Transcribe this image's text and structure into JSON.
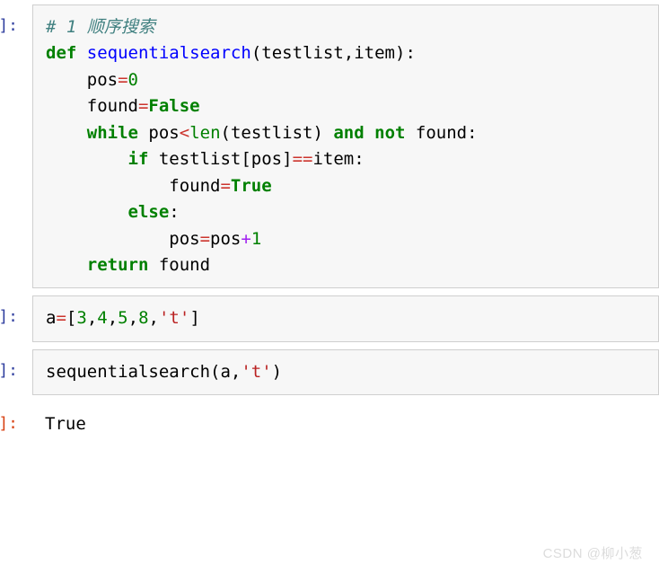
{
  "cell1": {
    "prompt_suffix": "]:",
    "c1": "# 1 顺序搜索",
    "kw_def": "def",
    "fn_name": "sequential",
    "fn_name2": "search",
    "open_paren": "(",
    "p1": "testlist",
    "comma1": ",",
    "p2": "item",
    "close_paren": "):",
    "l3a": "    pos",
    "eq1": "=",
    "zero": "0",
    "l4a": "    found",
    "eq2": "=",
    "false_kw": "False",
    "kw_while": "while",
    "l5a": " pos",
    "lt": "<",
    "len_fn": "len",
    "l5b": "(testlist) ",
    "kw_and": "and",
    "sp1": " ",
    "kw_not": "not",
    "l5c": " found:",
    "kw_if": "if",
    "l6a": " testlist[pos]",
    "eq3": "==",
    "l6b": "item:",
    "l7a": "            found",
    "eq4": "=",
    "true_kw": "True",
    "kw_else": "else",
    "colon": ":",
    "l9a": "            pos",
    "eq5": "=",
    "l9b": "pos",
    "plus": "+",
    "one": "1",
    "kw_return": "return",
    "l10a": " found"
  },
  "cell2": {
    "prompt_suffix": "]:",
    "a": "a",
    "eq": "=",
    "ob": "[",
    "n1": "3",
    "n2": "4",
    "n3": "5",
    "n4": "8",
    "c": ",",
    "s": "'t'",
    "cb": "]"
  },
  "cell3": {
    "prompt_suffix": "]:",
    "call1": "sequentialsearch(a,",
    "s": "'t'",
    "call2": ")"
  },
  "cell4": {
    "prompt_suffix": "]:",
    "out": "True"
  },
  "watermark": "CSDN @柳小葱"
}
